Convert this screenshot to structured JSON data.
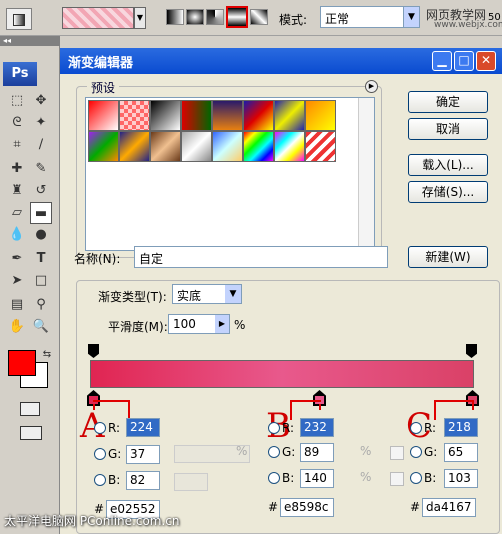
{
  "options_bar": {
    "mode_label": "模式:",
    "mode_value": "正常",
    "watermark_line1": "网页教学网",
    "watermark_line2": "www.webjx.com",
    "opacity_partial": "50"
  },
  "toolbox": {
    "logo": "Ps",
    "fg_color": "#ff0000",
    "bg_color": "#ffffff"
  },
  "dialog": {
    "title": "渐变编辑器",
    "presets_label": "预设",
    "buttons": {
      "ok": "确定",
      "cancel": "取消",
      "load": "载入(L)...",
      "save": "存储(S)...",
      "new": "新建(W)"
    },
    "name_label": "名称(N):",
    "name_value": "自定",
    "gradient_type_label": "渐变类型(T):",
    "gradient_type_value": "实底",
    "smoothness_label": "平滑度(M):",
    "smoothness_value": "100",
    "smoothness_unit": "%"
  },
  "presets": [
    {
      "icon": "gradient-swatch-icon"
    },
    {
      "icon": "gradient-swatch-icon"
    },
    {
      "icon": "gradient-swatch-icon"
    },
    {
      "icon": "gradient-swatch-icon"
    },
    {
      "icon": "gradient-swatch-icon"
    },
    {
      "icon": "gradient-swatch-icon"
    },
    {
      "icon": "gradient-swatch-icon"
    },
    {
      "icon": "gradient-swatch-icon"
    },
    {
      "icon": "gradient-swatch-icon"
    },
    {
      "icon": "gradient-swatch-icon"
    },
    {
      "icon": "gradient-swatch-icon"
    },
    {
      "icon": "gradient-swatch-icon"
    },
    {
      "icon": "gradient-swatch-icon"
    },
    {
      "icon": "gradient-swatch-icon"
    },
    {
      "icon": "gradient-swatch-icon"
    },
    {
      "icon": "gradient-swatch-icon"
    }
  ],
  "color_stops": [
    {
      "marker": "A",
      "r": "224",
      "g": "37",
      "b": "82",
      "hex": "e02552"
    },
    {
      "marker": "B",
      "r": "232",
      "g": "89",
      "b": "140",
      "hex": "e8598c"
    },
    {
      "marker": "C",
      "r": "218",
      "g": "65",
      "b": "103",
      "hex": "da4167"
    }
  ],
  "labels": {
    "r": "R:",
    "g": "G:",
    "b": "B:",
    "hash": "#",
    "pct": "%"
  },
  "footer_watermark": "太平洋电脑网 PConline.com.cn"
}
